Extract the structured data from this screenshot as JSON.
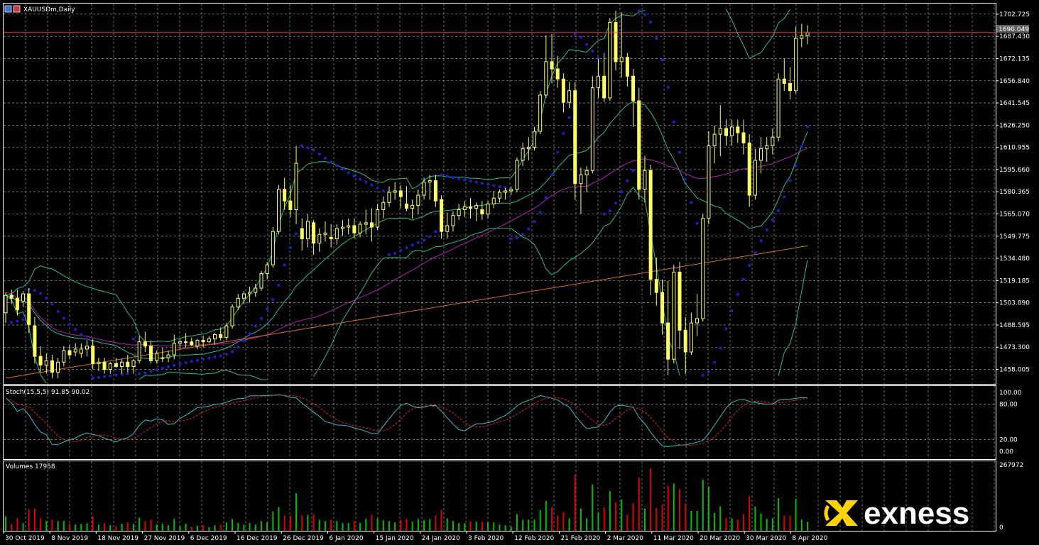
{
  "window": {
    "title": "XAUUSDm,Daily"
  },
  "colors": {
    "background": "#000000",
    "grid": "#ffffff",
    "bull_candle": "#ffff66",
    "bear_candle": "#ffff66",
    "bollinger": "#20c090",
    "sar": "#2020cc",
    "ma_magenta": "#b020b0",
    "ma_orange": "#d07020",
    "stoch_main": "#30c0c8",
    "stoch_signal": "#e02020",
    "vol_up": "#00c000",
    "vol_down": "#e00000",
    "hline": "#ff4040",
    "logo": "#ffd200"
  },
  "price_panel": {
    "current_price_label": "1690.049",
    "y_ticks": [
      "1702.725",
      "1687.430",
      "1672.135",
      "1656.840",
      "1641.545",
      "1626.250",
      "1610.955",
      "1595.660",
      "1580.365",
      "1565.070",
      "1549.775",
      "1534.480",
      "1519.185",
      "1503.890",
      "1488.595",
      "1473.300",
      "1458.005"
    ]
  },
  "stoch_panel": {
    "label": "Stoch(15,5,5) 91.85 90.02",
    "y_ticks": [
      "100.00",
      "80.00",
      "20.00",
      "0.00"
    ]
  },
  "volume_panel": {
    "label": "Volumes 17958",
    "y_ticks": [
      "267972",
      "0"
    ]
  },
  "x_axis": {
    "labels": [
      "30 Oct 2019",
      "8 Nov 2019",
      "18 Nov 2019",
      "27 Nov 2019",
      "6 Dec 2019",
      "16 Dec 2019",
      "26 Dec 2019",
      "6 Jan 2020",
      "15 Jan 2020",
      "24 Jan 2020",
      "3 Feb 2020",
      "12 Feb 2020",
      "21 Feb 2020",
      "2 Mar 2020",
      "11 Mar 2020",
      "20 Mar 2020",
      "30 Mar 2020",
      "8 Apr 2020"
    ]
  },
  "logo": {
    "text": "exness"
  },
  "chart_data": {
    "type": "candlestick",
    "symbol": "XAUUSDm",
    "timeframe": "Daily",
    "ylim": [
      1448,
      1710
    ],
    "hline": 1690.049,
    "candles": [
      [
        1497,
        1511,
        1490,
        1509
      ],
      [
        1509,
        1513,
        1503,
        1507
      ],
      [
        1507,
        1513,
        1495,
        1499
      ],
      [
        1505,
        1512,
        1501,
        1510
      ],
      [
        1510,
        1514,
        1483,
        1489
      ],
      [
        1488,
        1494,
        1462,
        1467
      ],
      [
        1467,
        1474,
        1456,
        1461
      ],
      [
        1461,
        1469,
        1455,
        1464
      ],
      [
        1464,
        1468,
        1452,
        1456
      ],
      [
        1456,
        1466,
        1452,
        1463
      ],
      [
        1463,
        1474,
        1460,
        1471
      ],
      [
        1471,
        1475,
        1465,
        1468
      ],
      [
        1470,
        1476,
        1467,
        1472
      ],
      [
        1469,
        1476,
        1466,
        1472
      ],
      [
        1472,
        1478,
        1467,
        1474
      ],
      [
        1474,
        1479,
        1458,
        1462
      ],
      [
        1462,
        1466,
        1457,
        1463
      ],
      [
        1463,
        1466,
        1455,
        1458
      ],
      [
        1458,
        1463,
        1455,
        1462
      ],
      [
        1462,
        1466,
        1459,
        1460
      ],
      [
        1460,
        1465,
        1455,
        1463
      ],
      [
        1463,
        1468,
        1456,
        1460
      ],
      [
        1460,
        1465,
        1455,
        1464
      ],
      [
        1464,
        1481,
        1462,
        1477
      ],
      [
        1477,
        1484,
        1470,
        1474
      ],
      [
        1474,
        1478,
        1462,
        1464
      ],
      [
        1464,
        1471,
        1462,
        1469
      ],
      [
        1466,
        1473,
        1463,
        1466
      ],
      [
        1466,
        1471,
        1463,
        1468
      ],
      [
        1468,
        1482,
        1465,
        1476
      ],
      [
        1476,
        1479,
        1472,
        1477
      ],
      [
        1477,
        1483,
        1473,
        1477
      ],
      [
        1477,
        1480,
        1474,
        1475
      ],
      [
        1474,
        1479,
        1472,
        1478
      ],
      [
        1478,
        1481,
        1473,
        1477
      ],
      [
        1477,
        1481,
        1476,
        1479
      ],
      [
        1479,
        1483,
        1475,
        1482
      ],
      [
        1482,
        1487,
        1478,
        1480
      ],
      [
        1480,
        1490,
        1478,
        1488
      ],
      [
        1488,
        1503,
        1486,
        1501
      ],
      [
        1501,
        1510,
        1499,
        1507
      ],
      [
        1507,
        1512,
        1503,
        1510
      ],
      [
        1510,
        1515,
        1504,
        1511
      ],
      [
        1511,
        1517,
        1508,
        1514
      ],
      [
        1514,
        1526,
        1512,
        1524
      ],
      [
        1524,
        1532,
        1520,
        1530
      ],
      [
        1530,
        1556,
        1528,
        1553
      ],
      [
        1553,
        1585,
        1551,
        1582
      ],
      [
        1582,
        1590,
        1568,
        1574
      ],
      [
        1574,
        1585,
        1563,
        1568
      ],
      [
        1568,
        1612,
        1558,
        1600
      ],
      [
        1555,
        1562,
        1540,
        1548
      ],
      [
        1548,
        1565,
        1542,
        1560
      ],
      [
        1559,
        1561,
        1537,
        1545
      ],
      [
        1545,
        1555,
        1539,
        1551
      ],
      [
        1551,
        1560,
        1546,
        1552
      ],
      [
        1549,
        1558,
        1542,
        1548
      ],
      [
        1548,
        1558,
        1544,
        1555
      ],
      [
        1555,
        1561,
        1550,
        1556
      ],
      [
        1556,
        1562,
        1551,
        1557
      ],
      [
        1557,
        1562,
        1548,
        1552
      ],
      [
        1552,
        1560,
        1549,
        1558
      ],
      [
        1558,
        1568,
        1551,
        1559
      ],
      [
        1559,
        1569,
        1546,
        1556
      ],
      [
        1556,
        1572,
        1554,
        1568
      ],
      [
        1568,
        1577,
        1562,
        1573
      ],
      [
        1573,
        1584,
        1570,
        1580
      ],
      [
        1580,
        1587,
        1575,
        1581
      ],
      [
        1581,
        1585,
        1569,
        1577
      ],
      [
        1572,
        1584,
        1567,
        1569
      ],
      [
        1569,
        1575,
        1562,
        1571
      ],
      [
        1571,
        1582,
        1565,
        1578
      ],
      [
        1578,
        1590,
        1575,
        1587
      ],
      [
        1587,
        1592,
        1575,
        1588
      ],
      [
        1588,
        1592,
        1570,
        1574
      ],
      [
        1575,
        1578,
        1548,
        1553
      ],
      [
        1553,
        1566,
        1548,
        1557
      ],
      [
        1557,
        1567,
        1553,
        1564
      ],
      [
        1564,
        1572,
        1561,
        1568
      ],
      [
        1568,
        1574,
        1563,
        1570
      ],
      [
        1570,
        1576,
        1562,
        1569
      ],
      [
        1569,
        1573,
        1560,
        1571
      ],
      [
        1568,
        1574,
        1561,
        1565
      ],
      [
        1565,
        1574,
        1562,
        1572
      ],
      [
        1572,
        1581,
        1569,
        1576
      ],
      [
        1576,
        1582,
        1573,
        1580
      ],
      [
        1580,
        1583,
        1575,
        1581
      ],
      [
        1581,
        1584,
        1578,
        1582
      ],
      [
        1582,
        1604,
        1580,
        1602
      ],
      [
        1602,
        1614,
        1598,
        1610
      ],
      [
        1610,
        1618,
        1602,
        1611
      ],
      [
        1611,
        1625,
        1609,
        1622
      ],
      [
        1622,
        1650,
        1620,
        1647
      ],
      [
        1647,
        1688,
        1645,
        1670
      ],
      [
        1670,
        1689,
        1655,
        1665
      ],
      [
        1665,
        1674,
        1652,
        1658
      ],
      [
        1658,
        1662,
        1635,
        1642
      ],
      [
        1642,
        1656,
        1638,
        1650
      ],
      [
        1650,
        1656,
        1575,
        1586
      ],
      [
        1586,
        1597,
        1565,
        1592
      ],
      [
        1592,
        1598,
        1580,
        1595
      ],
      [
        1595,
        1660,
        1593,
        1652
      ],
      [
        1652,
        1672,
        1645,
        1660
      ],
      [
        1660,
        1676,
        1642,
        1645
      ],
      [
        1645,
        1700,
        1643,
        1697
      ],
      [
        1697,
        1705,
        1664,
        1670
      ],
      [
        1670,
        1704,
        1659,
        1673
      ],
      [
        1673,
        1676,
        1653,
        1660
      ],
      [
        1660,
        1665,
        1625,
        1643
      ],
      [
        1643,
        1652,
        1575,
        1582
      ],
      [
        1582,
        1605,
        1573,
        1595
      ],
      [
        1595,
        1599,
        1509,
        1520
      ],
      [
        1520,
        1535,
        1502,
        1511
      ],
      [
        1511,
        1520,
        1482,
        1490
      ],
      [
        1490,
        1519,
        1454,
        1465
      ],
      [
        1465,
        1530,
        1462,
        1525
      ],
      [
        1525,
        1532,
        1472,
        1485
      ],
      [
        1485,
        1494,
        1455,
        1470
      ],
      [
        1470,
        1497,
        1468,
        1490
      ],
      [
        1490,
        1510,
        1481,
        1493
      ],
      [
        1493,
        1565,
        1491,
        1562
      ],
      [
        1562,
        1622,
        1558,
        1612
      ],
      [
        1612,
        1626,
        1600,
        1620
      ],
      [
        1620,
        1640,
        1605,
        1624
      ],
      [
        1624,
        1630,
        1612,
        1619
      ],
      [
        1619,
        1630,
        1612,
        1625
      ],
      [
        1625,
        1630,
        1614,
        1621
      ],
      [
        1621,
        1630,
        1606,
        1614
      ],
      [
        1614,
        1620,
        1570,
        1578
      ],
      [
        1578,
        1610,
        1575,
        1602
      ],
      [
        1602,
        1618,
        1593,
        1610
      ],
      [
        1610,
        1618,
        1601,
        1612
      ],
      [
        1612,
        1624,
        1606,
        1618
      ],
      [
        1618,
        1662,
        1615,
        1658
      ],
      [
        1658,
        1672,
        1650,
        1655
      ],
      [
        1655,
        1666,
        1644,
        1650
      ],
      [
        1650,
        1694,
        1648,
        1686
      ],
      [
        1686,
        1696,
        1680,
        1688
      ],
      [
        1688,
        1695,
        1682,
        1690
      ]
    ]
  }
}
